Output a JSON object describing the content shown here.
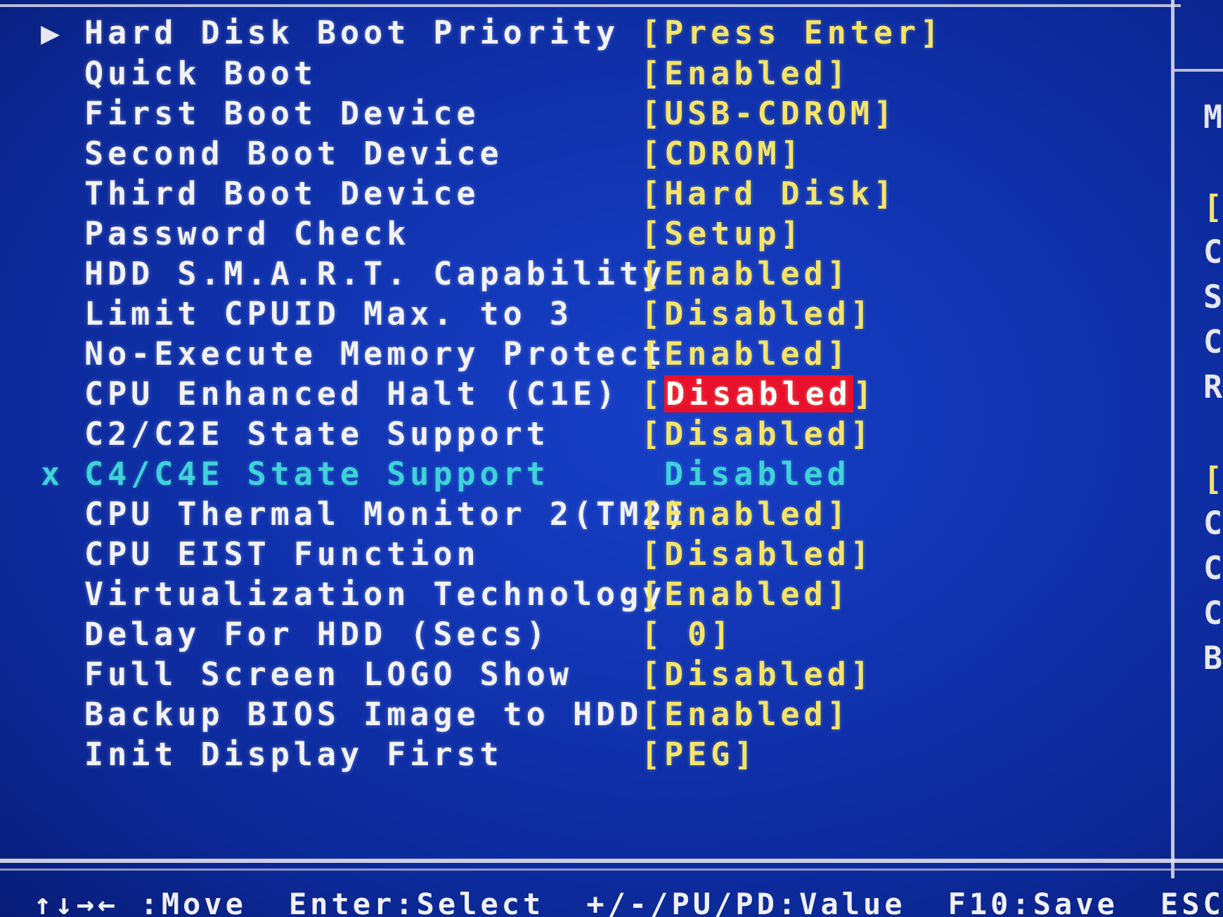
{
  "settings": [
    {
      "marker": "▶",
      "label": "Hard Disk Boot Priority",
      "value": "[Press Enter]"
    },
    {
      "marker": "",
      "label": "Quick Boot",
      "value": "[Enabled]"
    },
    {
      "marker": "",
      "label": "First Boot Device",
      "value": "[USB-CDROM]"
    },
    {
      "marker": "",
      "label": "Second Boot Device",
      "value": "[CDROM]"
    },
    {
      "marker": "",
      "label": "Third Boot Device",
      "value": "[Hard Disk]"
    },
    {
      "marker": "",
      "label": "Password Check",
      "value": "[Setup]"
    },
    {
      "marker": "",
      "label": "HDD S.M.A.R.T. Capability",
      "value": "[Enabled]"
    },
    {
      "marker": "",
      "label": "Limit CPUID Max. to 3",
      "value": "[Disabled]"
    },
    {
      "marker": "",
      "label": "No-Execute Memory Protect",
      "value": "[Enabled]"
    },
    {
      "marker": "",
      "label": "CPU Enhanced Halt (C1E)",
      "value_prefix": "[",
      "value_selected": "Disabled",
      "value_suffix": "]"
    },
    {
      "marker": "",
      "label": "C2/C2E State Support",
      "value": "[Disabled]"
    },
    {
      "marker": "x",
      "label": "C4/C4E State Support",
      "value": "Disabled"
    },
    {
      "marker": "",
      "label": "CPU Thermal Monitor 2(TM2)",
      "value": "[Enabled]"
    },
    {
      "marker": "",
      "label": "CPU EIST Function",
      "value": "[Disabled]"
    },
    {
      "marker": "",
      "label": "Virtualization Technology",
      "value": "[Enabled]"
    },
    {
      "marker": "",
      "label": "Delay For HDD (Secs)",
      "value": "[ 0]"
    },
    {
      "marker": "",
      "label": "Full Screen LOGO Show",
      "value": "[Disabled]"
    },
    {
      "marker": "",
      "label": "Backup BIOS Image to HDD",
      "value": "[Enabled]"
    },
    {
      "marker": "",
      "label": "Init Display First",
      "value": "[PEG]"
    }
  ],
  "right_panel": [
    "M",
    "[",
    "C",
    "S",
    "C",
    "R",
    "[",
    "C",
    "C",
    "C",
    "B"
  ],
  "footer": {
    "move": "↑↓→← :Move",
    "select": "Enter:Select",
    "value": "+/-/PU/PD:Value",
    "save": "F10:Save",
    "esc": "ESC"
  },
  "colors": {
    "background": "#1033b0",
    "label_text": "#f2f2f6",
    "value_text": "#f4e46a",
    "disabled_text": "#3fd2d8",
    "selection_highlight": "#e8102c"
  }
}
